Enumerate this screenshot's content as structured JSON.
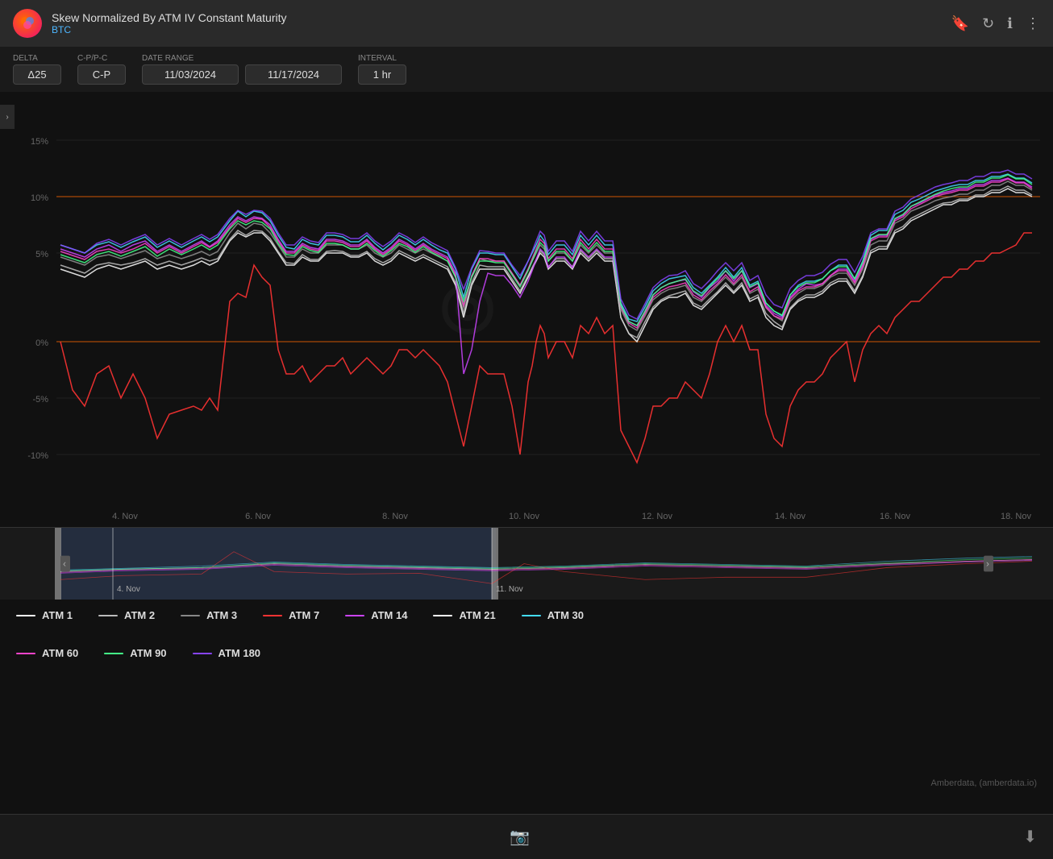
{
  "header": {
    "title": "Skew Normalized By ATM IV Constant Maturity",
    "subtitle": "BTC",
    "actions": [
      "bookmark-icon",
      "refresh-icon",
      "info-icon",
      "more-icon"
    ]
  },
  "controls": {
    "delta_label": "Delta",
    "delta_value": "Δ25",
    "cp_label": "C-P/P-C",
    "cp_value": "C-P",
    "date_range_label": "Date Range",
    "date_from": "11/03/2024",
    "date_to": "11/17/2024",
    "interval_label": "Interval",
    "interval_value": "1 hr"
  },
  "chart": {
    "y_ticks": [
      "15%",
      "10%",
      "5%",
      "0%",
      "-5%",
      "-10%"
    ],
    "x_ticks": [
      "4. Nov",
      "6. Nov",
      "8. Nov",
      "10. Nov",
      "12. Nov",
      "14. Nov",
      "16. Nov",
      "18. Nov"
    ],
    "ref_lines": [
      0,
      10
    ]
  },
  "legend": {
    "items": [
      {
        "label": "ATM 1",
        "color": "#ffffff"
      },
      {
        "label": "ATM 2",
        "color": "#bbbbbb"
      },
      {
        "label": "ATM 3",
        "color": "#888888"
      },
      {
        "label": "ATM 7",
        "color": "#ff3333"
      },
      {
        "label": "ATM 14",
        "color": "#cc44ff"
      },
      {
        "label": "ATM 21",
        "color": "#ffffff"
      },
      {
        "label": "ATM 30",
        "color": "#44ddff"
      },
      {
        "label": "ATM 60",
        "color": "#ff44cc"
      },
      {
        "label": "ATM 90",
        "color": "#44ff88"
      },
      {
        "label": "ATM 180",
        "color": "#8844ff"
      }
    ]
  },
  "footer": {
    "camera_icon": "📷",
    "download_icon": "⬇",
    "attribution": "Amberdata, (amberdata.io)"
  },
  "navigator": {
    "left_date": "4. Nov",
    "right_date": "11. Nov"
  }
}
